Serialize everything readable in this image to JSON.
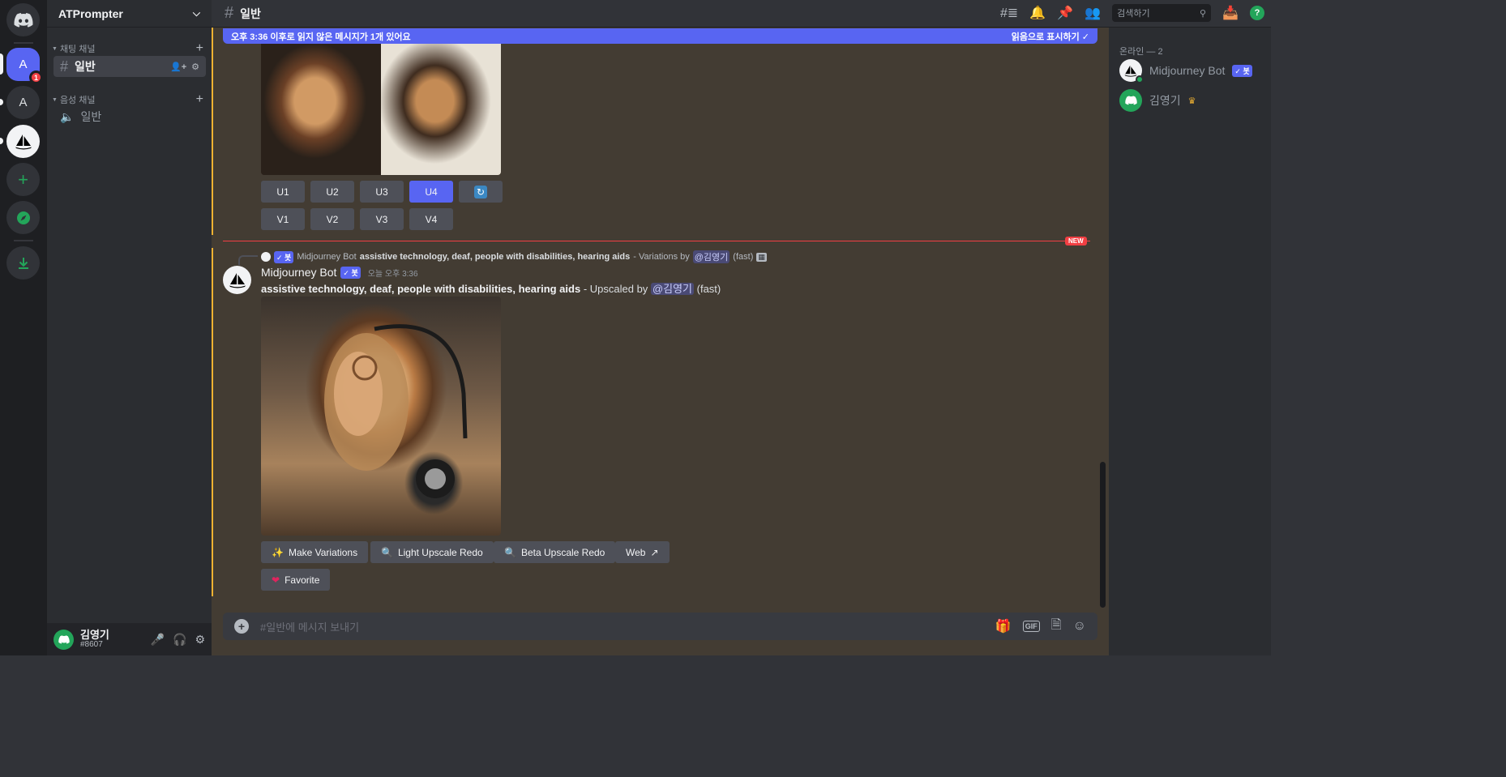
{
  "server": {
    "name": "ATPrompter",
    "rail": {
      "active_label": "A",
      "active_badge": "1",
      "second_label": "A"
    }
  },
  "sidebar": {
    "text_category": "채팅 채널",
    "voice_category": "음성 채널",
    "text_channel": "일반",
    "voice_channel": "일반"
  },
  "user": {
    "name": "김영기",
    "tag": "#8607"
  },
  "header": {
    "channel": "일반",
    "search_placeholder": "검색하기",
    "help": "?"
  },
  "unread": {
    "text": "오후 3:36 이후로 읽지 않은 메시지가 1개 있어요",
    "action": "읽음으로 표시하기"
  },
  "grid_buttons": {
    "upscale": [
      "U1",
      "U2",
      "U3",
      "U4"
    ],
    "variation": [
      "V1",
      "V2",
      "V3",
      "V4"
    ],
    "selected": "U4"
  },
  "new_marker": "NEW",
  "reply": {
    "bot_tag": "봇",
    "author": "Midjourney Bot",
    "prompt": "assistive technology, deaf, people with disabilities, hearing aids",
    "suffix": "- Variations by",
    "mention": "@김영기",
    "speed": "(fast)"
  },
  "message": {
    "author": "Midjourney Bot",
    "bot_tag": "봇",
    "time": "오늘 오후 3:36",
    "prompt": "assistive technology, deaf, people with disabilities, hearing aids",
    "suffix": "- Upscaled by",
    "mention": "@김영기",
    "speed": "(fast)"
  },
  "action_buttons": {
    "make_variations": "Make Variations",
    "light_upscale": "Light Upscale Redo",
    "beta_upscale": "Beta Upscale Redo",
    "web": "Web",
    "favorite": "Favorite"
  },
  "composer": {
    "placeholder": "#일반에 메시지 보내기",
    "gif": "GIF"
  },
  "members": {
    "header": "온라인 — 2",
    "list": [
      {
        "name": "Midjourney Bot",
        "tag": "봇"
      },
      {
        "name": "김영기"
      }
    ]
  },
  "colors": {
    "blurple": "#5865f2",
    "green": "#23a55a",
    "red": "#f23f43",
    "accent_gold": "#f0b232"
  }
}
